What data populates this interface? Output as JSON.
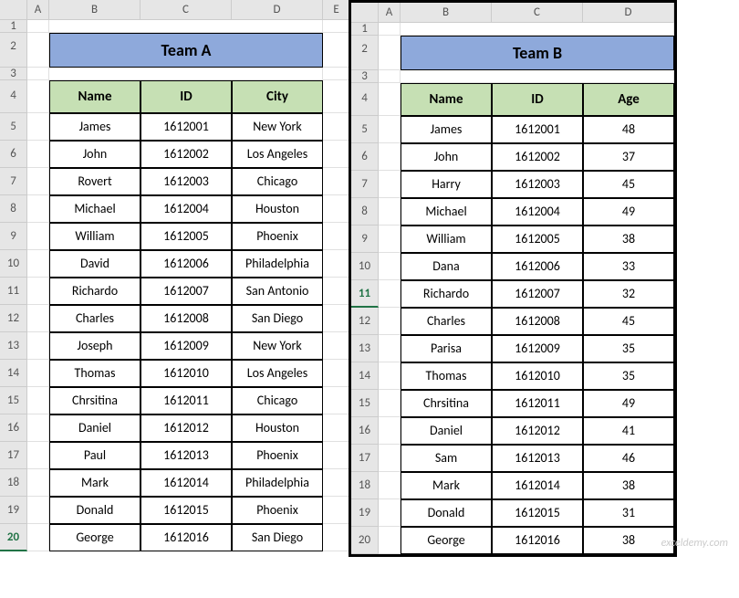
{
  "columns": [
    "A",
    "B",
    "C",
    "D",
    "E"
  ],
  "rowNumbers": [
    1,
    2,
    3,
    4,
    5,
    6,
    7,
    8,
    9,
    10,
    11,
    12,
    13,
    14,
    15,
    16,
    17,
    18,
    19,
    20
  ],
  "teamA": {
    "title": "Team A",
    "headers": [
      "Name",
      "ID",
      "City"
    ],
    "rows": [
      [
        "James",
        "1612001",
        "New York"
      ],
      [
        "John",
        "1612002",
        "Los Angeles"
      ],
      [
        "Rovert",
        "1612003",
        "Chicago"
      ],
      [
        "Michael",
        "1612004",
        "Houston"
      ],
      [
        "William",
        "1612005",
        "Phoenix"
      ],
      [
        "David",
        "1612006",
        "Philadelphia"
      ],
      [
        "Richardo",
        "1612007",
        "San Antonio"
      ],
      [
        "Charles",
        "1612008",
        "San Diego"
      ],
      [
        "Joseph",
        "1612009",
        "New York"
      ],
      [
        "Thomas",
        "1612010",
        "Los Angeles"
      ],
      [
        "Chrsitina",
        "1612011",
        "Chicago"
      ],
      [
        "Daniel",
        "1612012",
        "Houston"
      ],
      [
        "Paul",
        "1612013",
        "Phoenix"
      ],
      [
        "Mark",
        "1612014",
        "Philadelphia"
      ],
      [
        "Donald",
        "1612015",
        "Phoenix"
      ],
      [
        "George",
        "1612016",
        "San Diego"
      ]
    ],
    "activeRow": 20
  },
  "teamB": {
    "title": "Team B",
    "headers": [
      "Name",
      "ID",
      "Age"
    ],
    "rows": [
      [
        "James",
        "1612001",
        "48"
      ],
      [
        "John",
        "1612002",
        "37"
      ],
      [
        "Harry",
        "1612003",
        "45"
      ],
      [
        "Michael",
        "1612004",
        "49"
      ],
      [
        "William",
        "1612005",
        "38"
      ],
      [
        "Dana",
        "1612006",
        "33"
      ],
      [
        "Richardo",
        "1612007",
        "32"
      ],
      [
        "Charles",
        "1612008",
        "45"
      ],
      [
        "Parisa",
        "1612009",
        "35"
      ],
      [
        "Thomas",
        "1612010",
        "35"
      ],
      [
        "Chrsitina",
        "1612011",
        "49"
      ],
      [
        "Daniel",
        "1612012",
        "41"
      ],
      [
        "Sam",
        "1612013",
        "46"
      ],
      [
        "Mark",
        "1612014",
        "38"
      ],
      [
        "Donald",
        "1612015",
        "31"
      ],
      [
        "George",
        "1612016",
        "38"
      ]
    ],
    "activeRow": 11
  },
  "watermark": "exceldemy.com",
  "chart_data": [
    {
      "type": "table",
      "title": "Team A",
      "columns": [
        "Name",
        "ID",
        "City"
      ],
      "rows": [
        [
          "James",
          1612001,
          "New York"
        ],
        [
          "John",
          1612002,
          "Los Angeles"
        ],
        [
          "Rovert",
          1612003,
          "Chicago"
        ],
        [
          "Michael",
          1612004,
          "Houston"
        ],
        [
          "William",
          1612005,
          "Phoenix"
        ],
        [
          "David",
          1612006,
          "Philadelphia"
        ],
        [
          "Richardo",
          1612007,
          "San Antonio"
        ],
        [
          "Charles",
          1612008,
          "San Diego"
        ],
        [
          "Joseph",
          1612009,
          "New York"
        ],
        [
          "Thomas",
          1612010,
          "Los Angeles"
        ],
        [
          "Chrsitina",
          1612011,
          "Chicago"
        ],
        [
          "Daniel",
          1612012,
          "Houston"
        ],
        [
          "Paul",
          1612013,
          "Phoenix"
        ],
        [
          "Mark",
          1612014,
          "Philadelphia"
        ],
        [
          "Donald",
          1612015,
          "Phoenix"
        ],
        [
          "George",
          1612016,
          "San Diego"
        ]
      ]
    },
    {
      "type": "table",
      "title": "Team B",
      "columns": [
        "Name",
        "ID",
        "Age"
      ],
      "rows": [
        [
          "James",
          1612001,
          48
        ],
        [
          "John",
          1612002,
          37
        ],
        [
          "Harry",
          1612003,
          45
        ],
        [
          "Michael",
          1612004,
          49
        ],
        [
          "William",
          1612005,
          38
        ],
        [
          "Dana",
          1612006,
          33
        ],
        [
          "Richardo",
          1612007,
          32
        ],
        [
          "Charles",
          1612008,
          45
        ],
        [
          "Parisa",
          1612009,
          35
        ],
        [
          "Thomas",
          1612010,
          35
        ],
        [
          "Chrsitina",
          1612011,
          49
        ],
        [
          "Daniel",
          1612012,
          41
        ],
        [
          "Sam",
          1612013,
          46
        ],
        [
          "Mark",
          1612014,
          38
        ],
        [
          "Donald",
          1612015,
          31
        ],
        [
          "George",
          1612016,
          38
        ]
      ]
    }
  ]
}
